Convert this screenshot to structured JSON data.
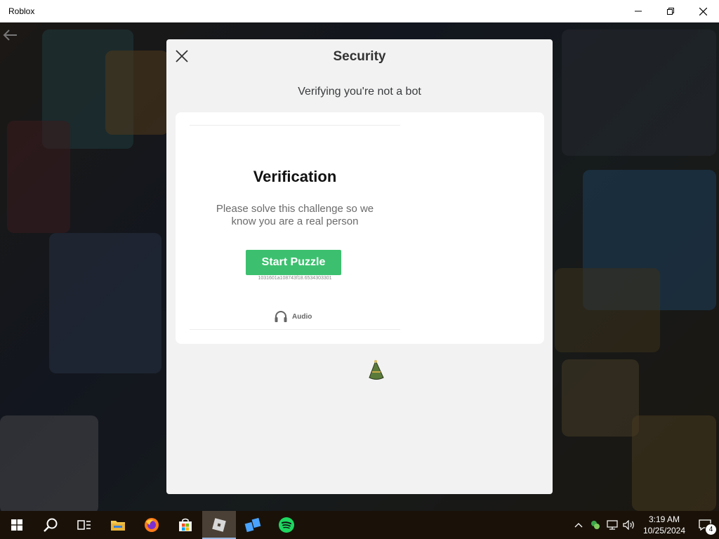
{
  "window": {
    "title": "Roblox"
  },
  "dialog": {
    "title": "Security",
    "subtitle": "Verifying you're not a bot",
    "challenge": {
      "heading": "Verification",
      "instructions": "Please solve this challenge so we know you are a real person",
      "button_label": "Start Puzzle",
      "session_id": "1031601a108743f18.6534303301",
      "audio_label": "Audio"
    }
  },
  "taskbar": {
    "apps": [
      {
        "name": "start",
        "icon": "windows-logo-icon"
      },
      {
        "name": "search",
        "icon": "search-icon"
      },
      {
        "name": "task-view",
        "icon": "task-view-icon"
      },
      {
        "name": "file-explorer",
        "icon": "folder-icon"
      },
      {
        "name": "firefox",
        "icon": "firefox-icon"
      },
      {
        "name": "microsoft-store",
        "icon": "store-icon"
      },
      {
        "name": "roblox",
        "icon": "roblox-icon",
        "active": true
      },
      {
        "name": "roblox-studio",
        "icon": "roblox-studio-icon"
      },
      {
        "name": "spotify",
        "icon": "spotify-icon"
      }
    ],
    "clock": {
      "time": "3:19 AM",
      "date": "10/25/2024"
    },
    "notification_count": "4"
  },
  "colors": {
    "start_button": "#3cc06f",
    "dialog_bg": "#f2f2f2",
    "taskbar_bg": "#1a1209"
  }
}
